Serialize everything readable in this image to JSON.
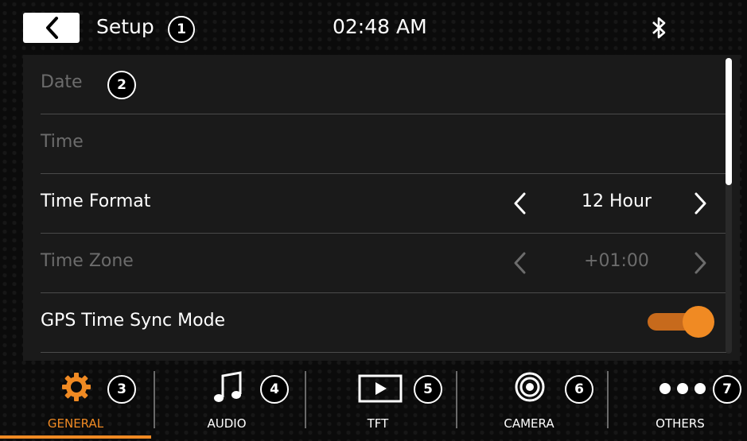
{
  "header": {
    "title": "Setup",
    "clock": "02:48 AM",
    "callout_title": "1"
  },
  "settings": {
    "callout_list": "2",
    "rows": [
      {
        "label": "Date"
      },
      {
        "label": "Time"
      },
      {
        "label": "Time Format",
        "value": "12 Hour"
      },
      {
        "label": "Time Zone",
        "value": "+01:00"
      },
      {
        "label": "GPS Time Sync Mode",
        "toggle_on": true
      }
    ]
  },
  "tabs": [
    {
      "label": "GENERAL",
      "callout": "3",
      "icon": "gear-icon",
      "active": true
    },
    {
      "label": "AUDIO",
      "callout": "4",
      "icon": "music-note-icon"
    },
    {
      "label": "TFT",
      "callout": "5",
      "icon": "play-screen-icon"
    },
    {
      "label": "CAMERA",
      "callout": "6",
      "icon": "camera-lens-icon"
    },
    {
      "label": "OTHERS",
      "callout": "7",
      "icon": "more-dots-icon"
    }
  ],
  "colors": {
    "accent": "#f08a23",
    "disabled_text": "#6c6c6c",
    "panel": "#1a1a1a"
  }
}
